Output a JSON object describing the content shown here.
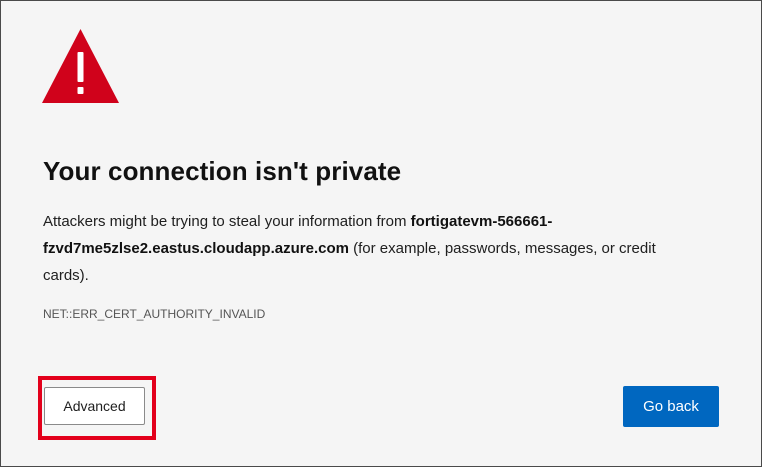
{
  "page": {
    "title": "Your connection isn't private",
    "icon": "warning-triangle-icon",
    "message_prefix": "Attackers might be trying to steal your information from ",
    "host": "fortigatevm-566661-fzvd7me5zlse2.eastus.cloudapp.azure.com",
    "message_suffix": " (for example, passwords, messages, or credit cards).",
    "error_code": "NET::ERR_CERT_AUTHORITY_INVALID"
  },
  "buttons": {
    "advanced_label": "Advanced",
    "go_back_label": "Go back"
  },
  "colors": {
    "warning_red": "#d0021b",
    "primary_blue": "#0067c0",
    "highlight_red": "#e3001b",
    "page_background": "#f5f5f5"
  }
}
